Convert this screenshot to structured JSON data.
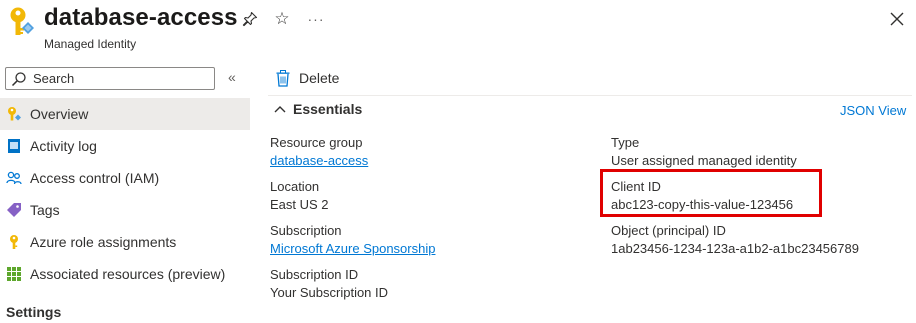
{
  "header": {
    "title": "database-access",
    "subtitle": "Managed Identity"
  },
  "sidebar": {
    "search_placeholder": "Search",
    "items": [
      {
        "label": "Overview",
        "icon": "overview-key-icon",
        "active": true
      },
      {
        "label": "Activity log",
        "icon": "activity-log-icon"
      },
      {
        "label": "Access control (IAM)",
        "icon": "people-icon"
      },
      {
        "label": "Tags",
        "icon": "tag-icon"
      },
      {
        "label": "Azure role assignments",
        "icon": "key-icon"
      },
      {
        "label": "Associated resources (preview)",
        "icon": "grid-icon"
      }
    ],
    "settings_heading": "Settings"
  },
  "toolbar": {
    "delete_label": "Delete"
  },
  "essentials": {
    "heading": "Essentials",
    "json_view_label": "JSON View",
    "left": [
      {
        "label": "Resource group",
        "value": "database-access",
        "link": true
      },
      {
        "label": "Location",
        "value": "East US 2",
        "link": false
      },
      {
        "label": "Subscription",
        "value": "Microsoft Azure Sponsorship",
        "link": true
      },
      {
        "label": "Subscription ID",
        "value": "Your Subscription ID",
        "link": false
      }
    ],
    "right": [
      {
        "label": "Type",
        "value": "User assigned managed identity"
      },
      {
        "label": "Client ID",
        "value": "abc123-copy-this-value-123456"
      },
      {
        "label": "Object (principal) ID",
        "value": "1ab23456-1234-123a-a1b2-a1bc23456789"
      }
    ]
  },
  "colors": {
    "link": "#0078d4",
    "highlight": "#e00000",
    "active_nav": "#edebe9"
  }
}
